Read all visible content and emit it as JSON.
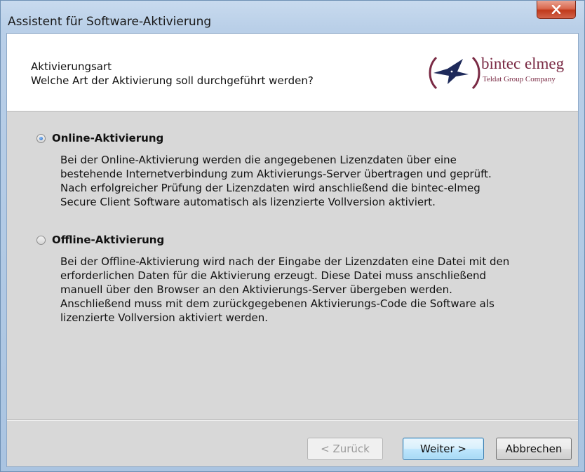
{
  "window": {
    "title": "Assistent für Software-Aktivierung",
    "close_label": "×"
  },
  "header": {
    "title": "Aktivierungsart",
    "subtitle": "Welche Art der Aktivierung soll durchgeführt werden?"
  },
  "logo": {
    "name": "bintec elmeg",
    "tagline": "Teldat Group Company",
    "accent_color": "#7a2a44",
    "bird_color": "#1e2a5a"
  },
  "options": [
    {
      "label": "Online-Aktivierung",
      "selected": true,
      "description": [
        "Bei der Online-Aktivierung werden die angegebenen Lizenzdaten über eine",
        "bestehende Internetverbindung zum Aktivierungs-Server übertragen und geprüft.",
        "Nach erfolgreicher Prüfung der Lizenzdaten wird anschließend die bintec-elmeg",
        "Secure Client Software automatisch als lizenzierte Vollversion aktiviert."
      ]
    },
    {
      "label": "Offline-Aktivierung",
      "selected": false,
      "description": [
        "Bei der Offline-Aktivierung wird nach der Eingabe der Lizenzdaten eine Datei mit den",
        "erforderlichen Daten für die Aktivierung erzeugt. Diese Datei muss anschließend",
        "manuell über den Browser an den Aktivierungs-Server übergeben werden.",
        "Anschließend muss mit dem zurückgegebenen Aktivierungs-Code die Software als",
        "lizenzierte Vollversion aktiviert werden."
      ]
    }
  ],
  "buttons": {
    "back": "< Zurück",
    "next": "Weiter >",
    "cancel": "Abbrechen"
  }
}
